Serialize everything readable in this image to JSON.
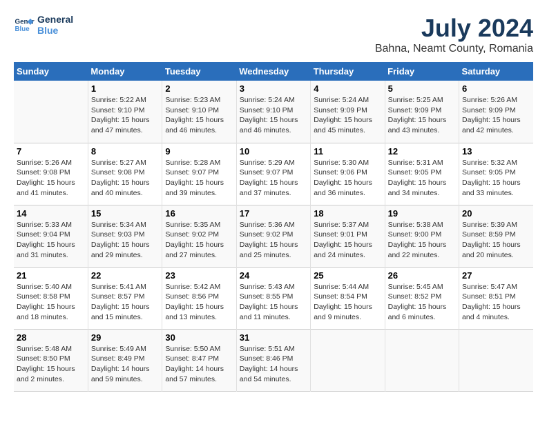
{
  "logo": {
    "line1": "General",
    "line2": "Blue"
  },
  "title": "July 2024",
  "subtitle": "Bahna, Neamt County, Romania",
  "weekdays": [
    "Sunday",
    "Monday",
    "Tuesday",
    "Wednesday",
    "Thursday",
    "Friday",
    "Saturday"
  ],
  "weeks": [
    [
      {
        "day": "",
        "info": ""
      },
      {
        "day": "1",
        "info": "Sunrise: 5:22 AM\nSunset: 9:10 PM\nDaylight: 15 hours and 47 minutes."
      },
      {
        "day": "2",
        "info": "Sunrise: 5:23 AM\nSunset: 9:10 PM\nDaylight: 15 hours and 46 minutes."
      },
      {
        "day": "3",
        "info": "Sunrise: 5:24 AM\nSunset: 9:10 PM\nDaylight: 15 hours and 46 minutes."
      },
      {
        "day": "4",
        "info": "Sunrise: 5:24 AM\nSunset: 9:09 PM\nDaylight: 15 hours and 45 minutes."
      },
      {
        "day": "5",
        "info": "Sunrise: 5:25 AM\nSunset: 9:09 PM\nDaylight: 15 hours and 43 minutes."
      },
      {
        "day": "6",
        "info": "Sunrise: 5:26 AM\nSunset: 9:09 PM\nDaylight: 15 hours and 42 minutes."
      }
    ],
    [
      {
        "day": "7",
        "info": "Sunrise: 5:26 AM\nSunset: 9:08 PM\nDaylight: 15 hours and 41 minutes."
      },
      {
        "day": "8",
        "info": "Sunrise: 5:27 AM\nSunset: 9:08 PM\nDaylight: 15 hours and 40 minutes."
      },
      {
        "day": "9",
        "info": "Sunrise: 5:28 AM\nSunset: 9:07 PM\nDaylight: 15 hours and 39 minutes."
      },
      {
        "day": "10",
        "info": "Sunrise: 5:29 AM\nSunset: 9:07 PM\nDaylight: 15 hours and 37 minutes."
      },
      {
        "day": "11",
        "info": "Sunrise: 5:30 AM\nSunset: 9:06 PM\nDaylight: 15 hours and 36 minutes."
      },
      {
        "day": "12",
        "info": "Sunrise: 5:31 AM\nSunset: 9:05 PM\nDaylight: 15 hours and 34 minutes."
      },
      {
        "day": "13",
        "info": "Sunrise: 5:32 AM\nSunset: 9:05 PM\nDaylight: 15 hours and 33 minutes."
      }
    ],
    [
      {
        "day": "14",
        "info": "Sunrise: 5:33 AM\nSunset: 9:04 PM\nDaylight: 15 hours and 31 minutes."
      },
      {
        "day": "15",
        "info": "Sunrise: 5:34 AM\nSunset: 9:03 PM\nDaylight: 15 hours and 29 minutes."
      },
      {
        "day": "16",
        "info": "Sunrise: 5:35 AM\nSunset: 9:02 PM\nDaylight: 15 hours and 27 minutes."
      },
      {
        "day": "17",
        "info": "Sunrise: 5:36 AM\nSunset: 9:02 PM\nDaylight: 15 hours and 25 minutes."
      },
      {
        "day": "18",
        "info": "Sunrise: 5:37 AM\nSunset: 9:01 PM\nDaylight: 15 hours and 24 minutes."
      },
      {
        "day": "19",
        "info": "Sunrise: 5:38 AM\nSunset: 9:00 PM\nDaylight: 15 hours and 22 minutes."
      },
      {
        "day": "20",
        "info": "Sunrise: 5:39 AM\nSunset: 8:59 PM\nDaylight: 15 hours and 20 minutes."
      }
    ],
    [
      {
        "day": "21",
        "info": "Sunrise: 5:40 AM\nSunset: 8:58 PM\nDaylight: 15 hours and 18 minutes."
      },
      {
        "day": "22",
        "info": "Sunrise: 5:41 AM\nSunset: 8:57 PM\nDaylight: 15 hours and 15 minutes."
      },
      {
        "day": "23",
        "info": "Sunrise: 5:42 AM\nSunset: 8:56 PM\nDaylight: 15 hours and 13 minutes."
      },
      {
        "day": "24",
        "info": "Sunrise: 5:43 AM\nSunset: 8:55 PM\nDaylight: 15 hours and 11 minutes."
      },
      {
        "day": "25",
        "info": "Sunrise: 5:44 AM\nSunset: 8:54 PM\nDaylight: 15 hours and 9 minutes."
      },
      {
        "day": "26",
        "info": "Sunrise: 5:45 AM\nSunset: 8:52 PM\nDaylight: 15 hours and 6 minutes."
      },
      {
        "day": "27",
        "info": "Sunrise: 5:47 AM\nSunset: 8:51 PM\nDaylight: 15 hours and 4 minutes."
      }
    ],
    [
      {
        "day": "28",
        "info": "Sunrise: 5:48 AM\nSunset: 8:50 PM\nDaylight: 15 hours and 2 minutes."
      },
      {
        "day": "29",
        "info": "Sunrise: 5:49 AM\nSunset: 8:49 PM\nDaylight: 14 hours and 59 minutes."
      },
      {
        "day": "30",
        "info": "Sunrise: 5:50 AM\nSunset: 8:47 PM\nDaylight: 14 hours and 57 minutes."
      },
      {
        "day": "31",
        "info": "Sunrise: 5:51 AM\nSunset: 8:46 PM\nDaylight: 14 hours and 54 minutes."
      },
      {
        "day": "",
        "info": ""
      },
      {
        "day": "",
        "info": ""
      },
      {
        "day": "",
        "info": ""
      }
    ]
  ]
}
